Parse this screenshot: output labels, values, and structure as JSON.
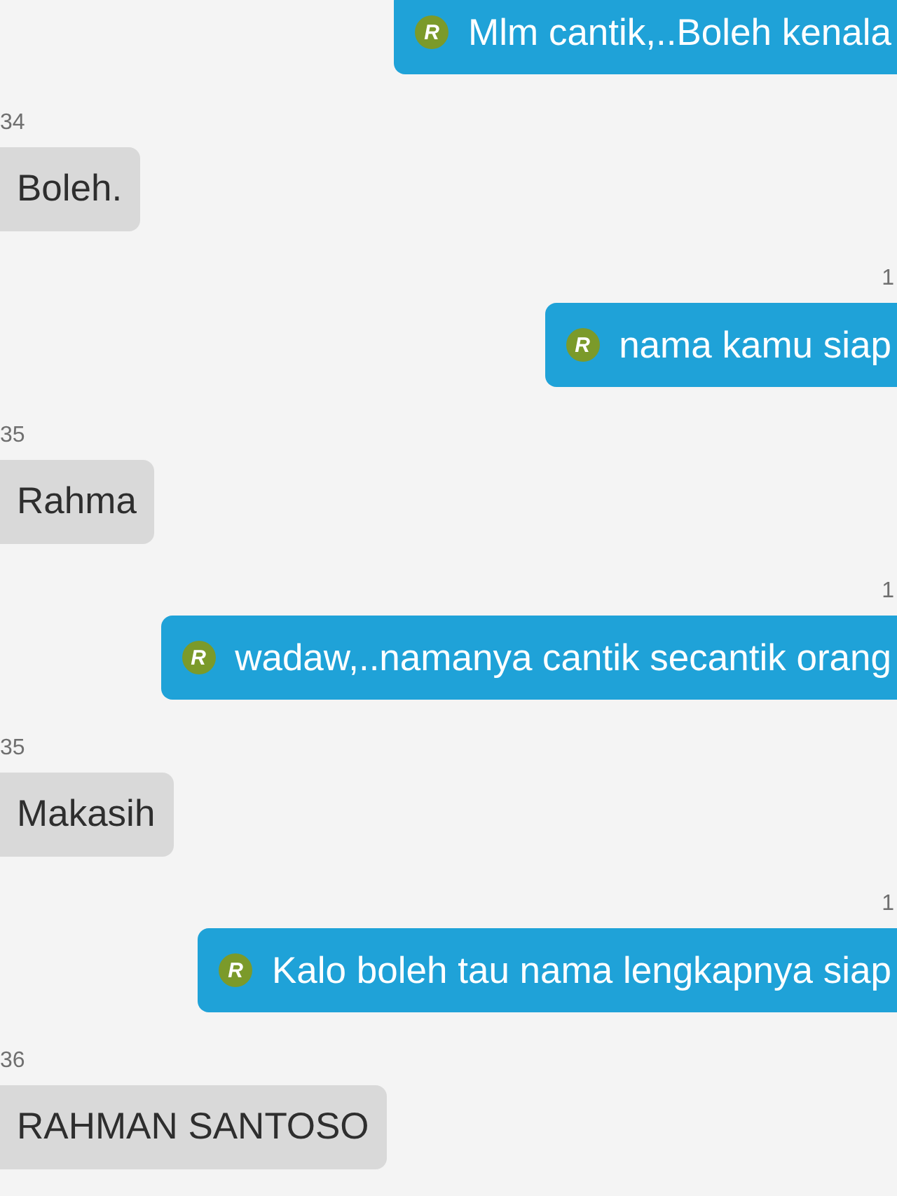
{
  "messages": [
    {
      "kind": "sent",
      "badge": "R",
      "text": "Mlm cantik,..Boleh kenala"
    },
    {
      "kind": "received",
      "time": "34",
      "text": "Boleh."
    },
    {
      "kind": "sent",
      "time": "1",
      "badge": "R",
      "text": "nama kamu siap"
    },
    {
      "kind": "received",
      "time": "35",
      "text": "Rahma"
    },
    {
      "kind": "sent",
      "time": "1",
      "badge": "R",
      "text": "wadaw,..namanya cantik secantik orang"
    },
    {
      "kind": "received",
      "time": "35",
      "text": "Makasih"
    },
    {
      "kind": "sent",
      "time": "1",
      "badge": "R",
      "text": "Kalo boleh tau nama lengkapnya siap"
    },
    {
      "kind": "received",
      "time": "36",
      "text": "RAHMAN SANTOSO"
    }
  ]
}
